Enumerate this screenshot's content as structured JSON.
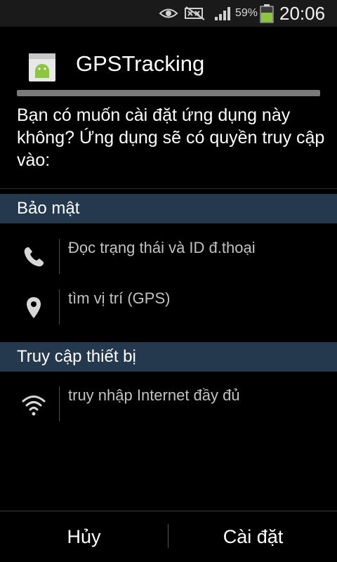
{
  "status_bar": {
    "battery_percent": "59%",
    "time": "20:06",
    "icons": [
      "eye-icon",
      "no-signal-icon",
      "signal-icon",
      "battery-icon"
    ]
  },
  "dialog": {
    "app_name": "GPSTracking",
    "app_icon": "android-app-icon",
    "prompt": "Bạn có muốn cài đặt ứng dụng này không? Ứng dụng sẽ có quyền truy cập vào:",
    "sections": [
      {
        "title": "Bảo mật",
        "permissions": [
          {
            "icon": "phone-icon",
            "label": "Đọc trạng thái và ID đ.thoại"
          },
          {
            "icon": "location-pin-icon",
            "label": "tìm vị trí (GPS)"
          }
        ]
      },
      {
        "title": "Truy cập thiết bị",
        "permissions": [
          {
            "icon": "wifi-icon",
            "label": "truy nhập Internet đầy đủ"
          }
        ]
      }
    ],
    "buttons": {
      "cancel": "Hủy",
      "install": "Cài đặt"
    }
  },
  "colors": {
    "section_header_bg": "#24394e",
    "background": "#000000",
    "status_bar_bg": "#1a1a1a"
  }
}
